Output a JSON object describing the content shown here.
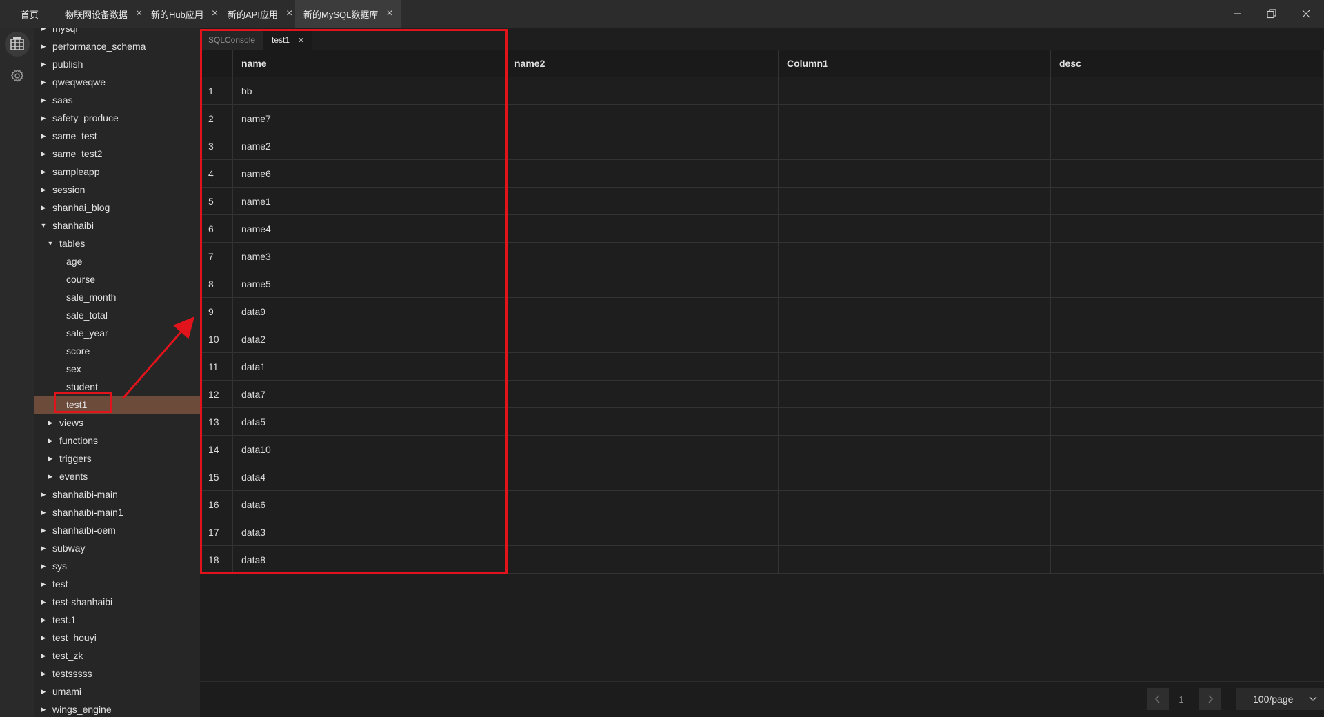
{
  "titlebar": {
    "tabs": [
      {
        "label": "首页",
        "closable": false,
        "active": false
      },
      {
        "label": "物联网设备数据",
        "closable": true,
        "active": false
      },
      {
        "label": "新的Hub应用",
        "closable": true,
        "active": false
      },
      {
        "label": "新的API应用",
        "closable": true,
        "active": false
      },
      {
        "label": "新的MySQL数据库",
        "closable": true,
        "active": true
      }
    ],
    "close_glyph": "×"
  },
  "rail": {
    "icons": [
      "database-icon",
      "settings-gear-icon"
    ]
  },
  "tree": {
    "items": [
      {
        "label": "mysql",
        "level": 0,
        "expandable": true,
        "expanded": false
      },
      {
        "label": "performance_schema",
        "level": 0,
        "expandable": true,
        "expanded": false
      },
      {
        "label": "publish",
        "level": 0,
        "expandable": true,
        "expanded": false
      },
      {
        "label": "qweqweqwe",
        "level": 0,
        "expandable": true,
        "expanded": false
      },
      {
        "label": "saas",
        "level": 0,
        "expandable": true,
        "expanded": false
      },
      {
        "label": "safety_produce",
        "level": 0,
        "expandable": true,
        "expanded": false
      },
      {
        "label": "same_test",
        "level": 0,
        "expandable": true,
        "expanded": false
      },
      {
        "label": "same_test2",
        "level": 0,
        "expandable": true,
        "expanded": false
      },
      {
        "label": "sampleapp",
        "level": 0,
        "expandable": true,
        "expanded": false
      },
      {
        "label": "session",
        "level": 0,
        "expandable": true,
        "expanded": false
      },
      {
        "label": "shanhai_blog",
        "level": 0,
        "expandable": true,
        "expanded": false
      },
      {
        "label": "shanhaibi",
        "level": 0,
        "expandable": true,
        "expanded": true
      },
      {
        "label": "tables",
        "level": 1,
        "expandable": true,
        "expanded": true
      },
      {
        "label": "age",
        "level": 2,
        "expandable": false
      },
      {
        "label": "course",
        "level": 2,
        "expandable": false
      },
      {
        "label": "sale_month",
        "level": 2,
        "expandable": false
      },
      {
        "label": "sale_total",
        "level": 2,
        "expandable": false
      },
      {
        "label": "sale_year",
        "level": 2,
        "expandable": false
      },
      {
        "label": "score",
        "level": 2,
        "expandable": false
      },
      {
        "label": "sex",
        "level": 2,
        "expandable": false
      },
      {
        "label": "student",
        "level": 2,
        "expandable": false
      },
      {
        "label": "test1",
        "level": 2,
        "expandable": false,
        "selected": true
      },
      {
        "label": "views",
        "level": 1,
        "expandable": true,
        "expanded": false
      },
      {
        "label": "functions",
        "level": 1,
        "expandable": true,
        "expanded": false
      },
      {
        "label": "triggers",
        "level": 1,
        "expandable": true,
        "expanded": false
      },
      {
        "label": "events",
        "level": 1,
        "expandable": true,
        "expanded": false
      },
      {
        "label": "shanhaibi-main",
        "level": 0,
        "expandable": true,
        "expanded": false
      },
      {
        "label": "shanhaibi-main1",
        "level": 0,
        "expandable": true,
        "expanded": false
      },
      {
        "label": "shanhaibi-oem",
        "level": 0,
        "expandable": true,
        "expanded": false
      },
      {
        "label": "subway",
        "level": 0,
        "expandable": true,
        "expanded": false
      },
      {
        "label": "sys",
        "level": 0,
        "expandable": true,
        "expanded": false
      },
      {
        "label": "test",
        "level": 0,
        "expandable": true,
        "expanded": false
      },
      {
        "label": "test-shanhaibi",
        "level": 0,
        "expandable": true,
        "expanded": false
      },
      {
        "label": "test.1",
        "level": 0,
        "expandable": true,
        "expanded": false
      },
      {
        "label": "test_houyi",
        "level": 0,
        "expandable": true,
        "expanded": false
      },
      {
        "label": "test_zk",
        "level": 0,
        "expandable": true,
        "expanded": false
      },
      {
        "label": "testsssss",
        "level": 0,
        "expandable": true,
        "expanded": false
      },
      {
        "label": "umami",
        "level": 0,
        "expandable": true,
        "expanded": false
      },
      {
        "label": "wings_engine",
        "level": 0,
        "expandable": true,
        "expanded": false
      }
    ]
  },
  "subtabs": [
    {
      "label": "SQLConsole",
      "active": false,
      "closable": false
    },
    {
      "label": "test1",
      "active": true,
      "closable": true
    }
  ],
  "table": {
    "columns": [
      "",
      "name",
      "name2",
      "Column1",
      "desc"
    ],
    "rows": [
      [
        "1",
        "bb",
        "",
        "",
        ""
      ],
      [
        "2",
        "name7",
        "",
        "",
        ""
      ],
      [
        "3",
        "name2",
        "",
        "",
        ""
      ],
      [
        "4",
        "name6",
        "",
        "",
        ""
      ],
      [
        "5",
        "name1",
        "",
        "",
        ""
      ],
      [
        "6",
        "name4",
        "",
        "",
        ""
      ],
      [
        "7",
        "name3",
        "",
        "",
        ""
      ],
      [
        "8",
        "name5",
        "",
        "",
        ""
      ],
      [
        "9",
        "data9",
        "",
        "",
        ""
      ],
      [
        "10",
        "data2",
        "",
        "",
        ""
      ],
      [
        "11",
        "data1",
        "",
        "",
        ""
      ],
      [
        "12",
        "data7",
        "",
        "",
        ""
      ],
      [
        "13",
        "data5",
        "",
        "",
        ""
      ],
      [
        "14",
        "data10",
        "",
        "",
        ""
      ],
      [
        "15",
        "data4",
        "",
        "",
        ""
      ],
      [
        "16",
        "data6",
        "",
        "",
        ""
      ],
      [
        "17",
        "data3",
        "",
        "",
        ""
      ],
      [
        "18",
        "data8",
        "",
        "",
        ""
      ]
    ]
  },
  "pagination": {
    "prev_icon": "chevron-left-icon",
    "current_page": "1",
    "next_icon": "chevron-right-icon",
    "page_size": "100/page"
  },
  "annotation": {
    "color": "#e1141b"
  }
}
